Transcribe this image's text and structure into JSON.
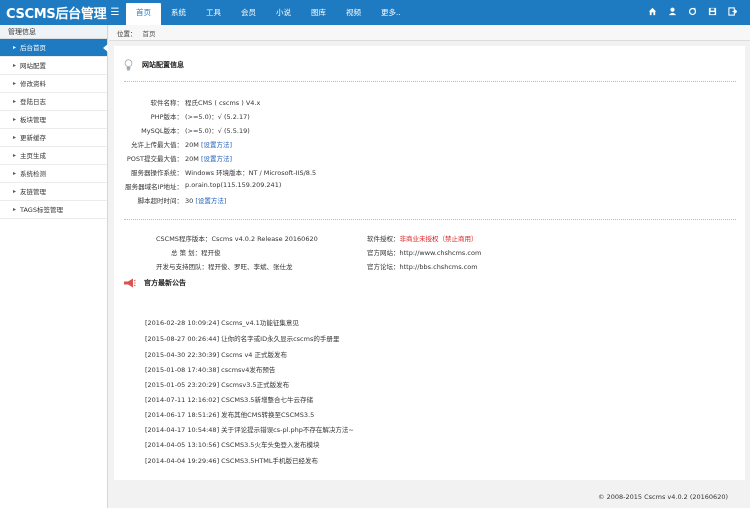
{
  "header": {
    "logo": "CSCMS后台管理",
    "menu_icon": "menu-icon",
    "nav": [
      "首页",
      "系统",
      "工具",
      "会员",
      "小说",
      "图库",
      "视频",
      "更多.."
    ],
    "icons": [
      "home-icon",
      "user-icon",
      "refresh-icon",
      "save-icon",
      "exit-icon"
    ]
  },
  "sidebar": {
    "title": "管理信息",
    "items": [
      "后台首页",
      "网站配置",
      "修改资料",
      "登陆日志",
      "板块管理",
      "更新缓存",
      "主页生成",
      "系统检测",
      "友链管理",
      "TAGS标签管理"
    ]
  },
  "breadcrumb": {
    "label": "位置：",
    "current": "首页"
  },
  "site_info": {
    "title": "网站配置信息",
    "rows": [
      {
        "label": "软件名称：",
        "value": "程氏CMS ( cscms ) V4.x",
        "link": ""
      },
      {
        "label": "PHP版本：",
        "value": "(>=5.0)：√  (5.2.17)",
        "link": ""
      },
      {
        "label": "MySQL版本：",
        "value": "(>=5.0)：√  (5.5.19)",
        "link": ""
      },
      {
        "label": "允许上传最大值：",
        "value": "20M",
        "link": "[设置方法]"
      },
      {
        "label": "POST提交最大值：",
        "value": "20M",
        "link": "[设置方法]"
      },
      {
        "label": "服务器操作系统：",
        "value": "Windows  环境版本：NT / Microsoft-IIS/8.5",
        "link": ""
      },
      {
        "label": "服务器域名IP地址：",
        "value": "p.orain.top(115.159.209.241)",
        "link": ""
      },
      {
        "label": "脚本超时时间：",
        "value": "30",
        "link": "[设置方法]"
      }
    ]
  },
  "credits": {
    "version_label": "CSCMS程序版本：",
    "version_value": "Cscms v4.0.2 Release 20160620",
    "planner_label": "总 策 划：",
    "planner_value": "程开俊",
    "devs_label": "开发与支持团队：",
    "devs_value": "程开俊、罗旺、李斌、张仕龙",
    "auth_label": "软件授权：",
    "auth_value": "非商业未授权（禁止商用）",
    "site_label": "官方网站：",
    "site_value": "http://www.chshcms.com",
    "forum_label": "官方论坛：",
    "forum_value": "http://bbs.chshcms.com"
  },
  "news": {
    "title": "官方最新公告",
    "items": [
      "[2016-02-28 10:09:24] Cscms_v4.1功能征集意见",
      "[2015-08-27 00:26:44] 让你的名字或ID永久显示cscms的手册里",
      "[2015-04-30 22:30:39] Cscms v4 正式版发布",
      "[2015-01-08 17:40:38] cscmsv4发布预告",
      "[2015-01-05 23:20:29] Cscmsv3.5正式版发布",
      "[2014-07-11 12:16:02] CSCMS3.5新增整合七牛云存储",
      "[2014-06-17 18:51:26] 发布其他CMS转换至CSCMS3.5",
      "[2014-04-17 10:54:48] 关于评论提示错误cs-pl.php不存在解决方法~",
      "[2014-04-05 13:10:56] CSCMS3.5火车头免登入发布模块",
      "[2014-04-04 19:29:46] CSCMS3.5HTML手机版已经发布"
    ]
  },
  "footer": "© 2008-2015  Cscms v4.0.2 (20160620)"
}
